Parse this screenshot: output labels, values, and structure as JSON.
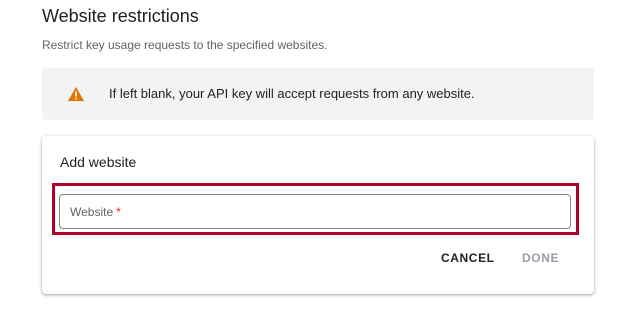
{
  "section": {
    "title": "Website restrictions",
    "subtitle": "Restrict key usage requests to the specified websites."
  },
  "warning": {
    "icon": "warning-triangle-icon",
    "icon_color": "#e37400",
    "text": "If left blank, your API key will accept requests from any website."
  },
  "add_card": {
    "title": "Add website",
    "input": {
      "label": "Website",
      "required_marker": "*",
      "value": ""
    },
    "buttons": {
      "cancel": "CANCEL",
      "done": "DONE"
    }
  },
  "colors": {
    "highlight_border": "#b0002a",
    "required": "#d93025",
    "disabled_text": "#9aa0a6"
  }
}
